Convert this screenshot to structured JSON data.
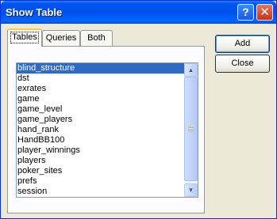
{
  "window": {
    "title": "Show Table",
    "help_glyph": "?",
    "close_glyph": "✕"
  },
  "tabs": [
    {
      "label": "Tables",
      "active": true
    },
    {
      "label": "Queries",
      "active": false
    },
    {
      "label": "Both",
      "active": false
    }
  ],
  "table_list": {
    "selected_index": 0,
    "items": [
      "blind_structure",
      "dst",
      "exrates",
      "game",
      "game_level",
      "game_players",
      "hand_rank",
      "HandBB100",
      "player_winnings",
      "players",
      "poker_sites",
      "prefs",
      "session"
    ]
  },
  "scrollbar": {
    "up_glyph": "▲",
    "down_glyph": "▼"
  },
  "buttons": {
    "add_label": "Add",
    "close_label": "Close"
  },
  "colors": {
    "titlebar": "#0054e3",
    "selection": "#316ac5",
    "dialog_face": "#ece9d8",
    "tab_highlight": "#ffc83c"
  }
}
